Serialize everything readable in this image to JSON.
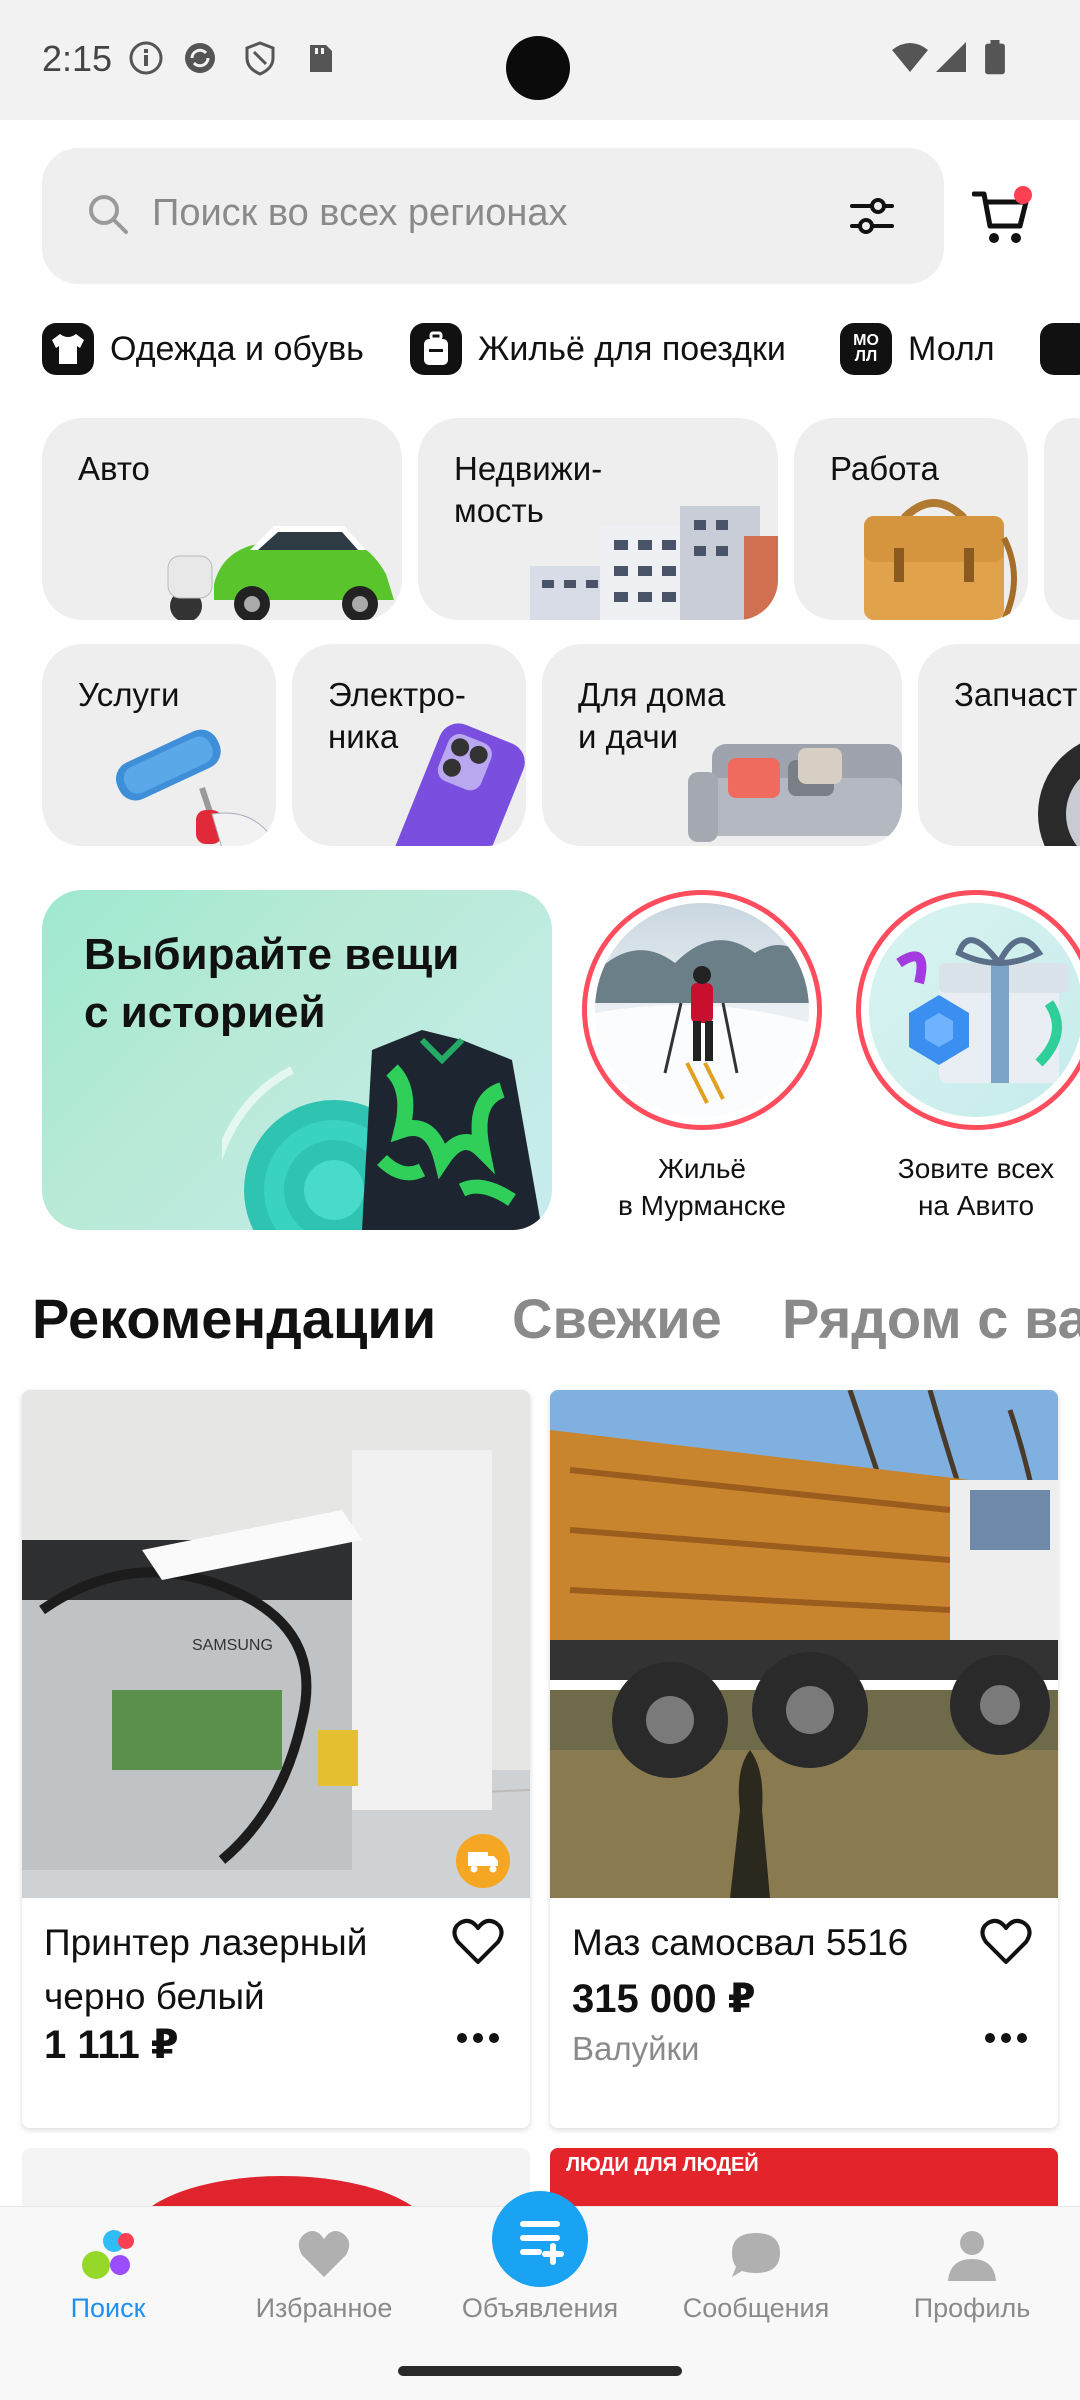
{
  "status_bar": {
    "time": "2:15"
  },
  "search": {
    "placeholder": "Поиск во всех регионах"
  },
  "chips": [
    {
      "label": "Одежда и обувь",
      "icon": "tshirt-icon"
    },
    {
      "label": "Жильё для поездки",
      "icon": "suitcase-icon"
    },
    {
      "label": "Молл",
      "icon": "mall-icon",
      "icon_text_top": "МО",
      "icon_text_bottom": "ЛЛ"
    }
  ],
  "categories_row1": [
    {
      "label": "Авто"
    },
    {
      "label": "Недвижи-\nмость"
    },
    {
      "label": "Работа"
    }
  ],
  "categories_row2": [
    {
      "label": "Услуги"
    },
    {
      "label": "Электро-\nника"
    },
    {
      "label": "Для дома\nи дачи"
    },
    {
      "label": "Запчаст"
    }
  ],
  "promo": {
    "title": "Выбирайте вещи\nс историей"
  },
  "stories": [
    {
      "caption": "Жильё\nв Мурманске"
    },
    {
      "caption": "Зовите всех\nна Авито"
    }
  ],
  "tabs": [
    {
      "label": "Рекомендации",
      "active": true
    },
    {
      "label": "Свежие",
      "active": false
    },
    {
      "label": "Рядом с ва",
      "active": false
    }
  ],
  "listings": [
    {
      "title": "Принтер лазерный черно белый",
      "price": "1 111 ₽",
      "location": "",
      "delivery": true
    },
    {
      "title": "Маз самосвал 5516",
      "price": "315 000 ₽",
      "location": "Валуйки",
      "delivery": false
    }
  ],
  "partial_listing_text": "ЛЮДИ ДЛЯ ЛЮДЕЙ",
  "bottom_nav": [
    {
      "label": "Поиск",
      "icon": "search-dots-icon",
      "active": true
    },
    {
      "label": "Избранное",
      "icon": "heart-icon",
      "active": false
    },
    {
      "label": "Объявления",
      "icon": "add-listing-icon",
      "active": false
    },
    {
      "label": "Сообщения",
      "icon": "chat-icon",
      "active": false
    },
    {
      "label": "Профиль",
      "icon": "profile-icon",
      "active": false
    }
  ],
  "colors": {
    "accent": "#1aa3f2",
    "active_nav": "#1f8ff0",
    "story_ring": "#ff4d5e",
    "cart_dot": "#ff4053"
  }
}
